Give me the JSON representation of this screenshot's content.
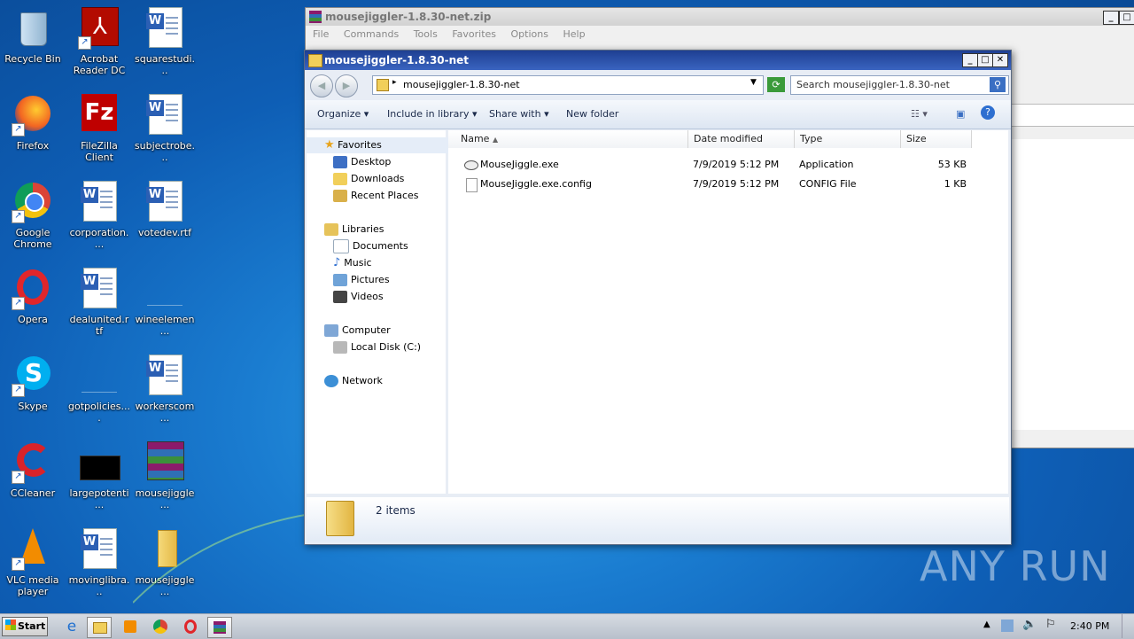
{
  "desktop_icons": [
    {
      "label": "Recycle Bin",
      "icon": "recycle-bin-icon"
    },
    {
      "label": "Acrobat Reader DC",
      "icon": "acrobat-icon"
    },
    {
      "label": "squarestudi...",
      "icon": "word-doc-icon"
    },
    {
      "label": "Firefox",
      "icon": "firefox-icon"
    },
    {
      "label": "FileZilla Client",
      "icon": "filezilla-icon"
    },
    {
      "label": "subjectrobe...",
      "icon": "word-doc-icon"
    },
    {
      "label": "Google Chrome",
      "icon": "chrome-icon"
    },
    {
      "label": "corporation....",
      "icon": "word-doc-icon"
    },
    {
      "label": "votedev.rtf",
      "icon": "word-doc-icon"
    },
    {
      "label": "Opera",
      "icon": "opera-icon"
    },
    {
      "label": "dealunited.rtf",
      "icon": "word-doc-icon"
    },
    {
      "label": "wineelemen...",
      "icon": "blank-file-icon"
    },
    {
      "label": "Skype",
      "icon": "skype-icon"
    },
    {
      "label": "gotpolicies....",
      "icon": "blank-file-icon"
    },
    {
      "label": "workerscom...",
      "icon": "word-doc-icon"
    },
    {
      "label": "CCleaner",
      "icon": "ccleaner-icon"
    },
    {
      "label": "largepotenti...",
      "icon": "black-file-icon"
    },
    {
      "label": "mousejiggle...",
      "icon": "winrar-icon"
    },
    {
      "label": "VLC media player",
      "icon": "vlc-icon"
    },
    {
      "label": "movinglibra...",
      "icon": "word-doc-icon"
    },
    {
      "label": "mousejiggle...",
      "icon": "folder-icon"
    }
  ],
  "archive_window": {
    "title": "mousejiggler-1.8.30-net.zip",
    "menu": [
      "File",
      "Commands",
      "Tools",
      "Favorites",
      "Options",
      "Help"
    ]
  },
  "explorer": {
    "title": "mousejiggler-1.8.30-net",
    "address": "mousejiggler-1.8.30-net",
    "search_placeholder": "Search mousejiggler-1.8.30-net",
    "commands": {
      "organize": "Organize",
      "include": "Include in library",
      "share": "Share with",
      "new_folder": "New folder"
    },
    "nav": {
      "favorites": "Favorites",
      "desktop": "Desktop",
      "downloads": "Downloads",
      "recent": "Recent Places",
      "libraries": "Libraries",
      "documents": "Documents",
      "music": "Music",
      "pictures": "Pictures",
      "videos": "Videos",
      "computer": "Computer",
      "local_disk": "Local Disk (C:)",
      "network": "Network"
    },
    "columns": {
      "name": "Name",
      "date": "Date modified",
      "type": "Type",
      "size": "Size"
    },
    "files": [
      {
        "name": "MouseJiggle.exe",
        "date": "7/9/2019 5:12 PM",
        "type": "Application",
        "size": "53 KB"
      },
      {
        "name": "MouseJiggle.exe.config",
        "date": "7/9/2019 5:12 PM",
        "type": "CONFIG File",
        "size": "1 KB"
      }
    ],
    "status": "2 items"
  },
  "taskbar": {
    "start_label": "Start",
    "clock": "2:40 PM"
  },
  "watermark": "ANY RUN"
}
